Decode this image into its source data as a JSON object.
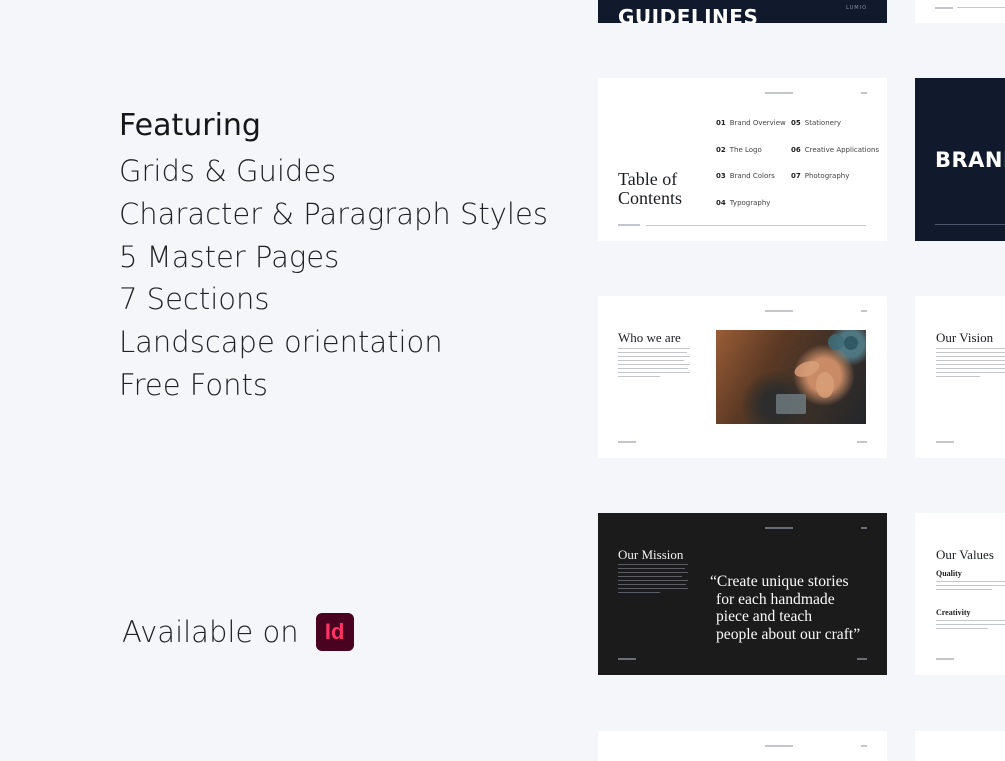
{
  "features": {
    "heading": "Featuring",
    "items": [
      "Grids & Guides",
      "Character & Paragraph Styles",
      "5 Master Pages",
      "7 Sections",
      "Landscape orientation",
      "Free Fonts"
    ]
  },
  "available": {
    "label": "Available on",
    "app_icon_text": "Id"
  },
  "slides": {
    "guidelines": {
      "title": "GUIDELINES",
      "logo": "LUMIO"
    },
    "toc": {
      "title_line1": "Table of",
      "title_line2": "Contents",
      "entries": [
        {
          "num": "01",
          "label": "Brand Overview"
        },
        {
          "num": "02",
          "label": "The Logo"
        },
        {
          "num": "03",
          "label": "Brand Colors"
        },
        {
          "num": "04",
          "label": "Typography"
        },
        {
          "num": "05",
          "label": "Stationery"
        },
        {
          "num": "06",
          "label": "Creative Applications"
        },
        {
          "num": "07",
          "label": "Photography"
        }
      ]
    },
    "brand": {
      "title": "BRAND"
    },
    "who_we_are": {
      "title": "Who we are"
    },
    "vision": {
      "title": "Our Vision"
    },
    "mission": {
      "title": "Our Mission",
      "quote": [
        "“Create unique stories",
        "for each handmade",
        "piece and teach",
        "people about our craft”"
      ]
    },
    "values": {
      "title": "Our Values",
      "sub1": "Quality",
      "sub2": "Creativity"
    }
  },
  "colors": {
    "page_background": "#f5f6fa",
    "navy_slide": "#111a2c",
    "black_slide": "#1b1b1b",
    "indesign_icon_bg": "#49021f",
    "indesign_icon_text": "#ff3366"
  }
}
